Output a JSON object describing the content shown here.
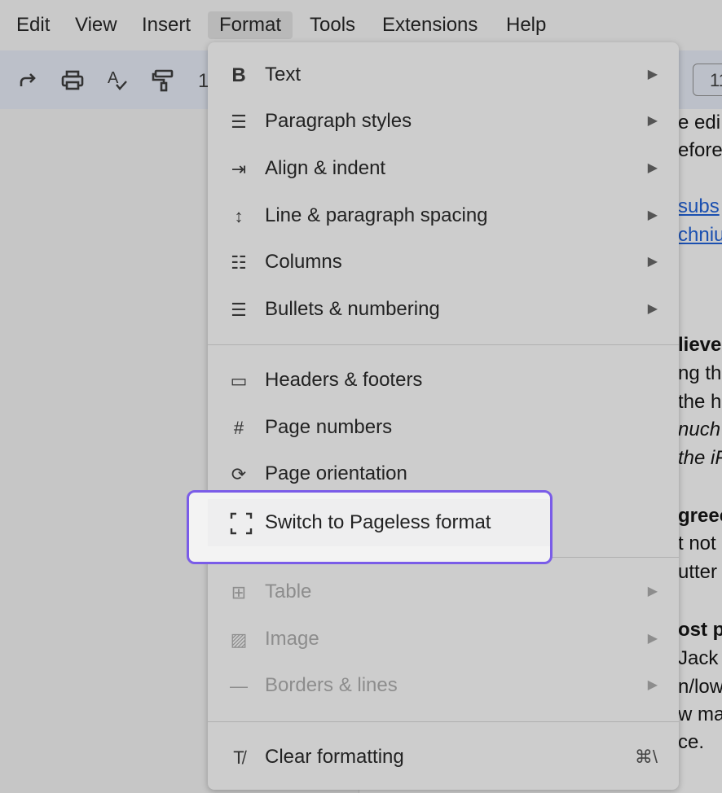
{
  "menubar": {
    "items": [
      "Edit",
      "View",
      "Insert",
      "Format",
      "Tools",
      "Extensions",
      "Help"
    ],
    "active": "Format"
  },
  "toolbar": {
    "icons": [
      "redo-icon",
      "print-icon",
      "spellcheck-icon",
      "paint-format-icon"
    ],
    "zoom_partial": "1",
    "font_size_partial": "11"
  },
  "document": {
    "lines": [
      {
        "t": "e edi",
        "s": ""
      },
      {
        "t": "efore",
        "s": ""
      },
      {
        "t": "subs",
        "s": "a"
      },
      {
        "t": "chniu",
        "s": "a"
      },
      {
        "t": "lieve",
        "s": "b"
      },
      {
        "t": "ng th",
        "s": ""
      },
      {
        "t": "the h",
        "s": ""
      },
      {
        "t": "nuch",
        "s": "i"
      },
      {
        "t": "the iF",
        "s": "i"
      },
      {
        "t": "greec",
        "s": "b"
      },
      {
        "t": "t not",
        "s": ""
      },
      {
        "t": "utter",
        "s": ""
      },
      {
        "t": "ost p",
        "s": "b"
      },
      {
        "t": "Jack",
        "s": ""
      },
      {
        "t": "n/low",
        "s": ""
      },
      {
        "t": "w ma",
        "s": ""
      },
      {
        "t": "ce.",
        "s": ""
      }
    ]
  },
  "format_menu": {
    "groups": [
      [
        {
          "label": "Text",
          "icon": "bold-icon",
          "submenu": true
        },
        {
          "label": "Paragraph styles",
          "icon": "paragraph-styles-icon",
          "submenu": true
        },
        {
          "label": "Align & indent",
          "icon": "indent-icon",
          "submenu": true
        },
        {
          "label": "Line & paragraph spacing",
          "icon": "line-spacing-icon",
          "submenu": true
        },
        {
          "label": "Columns",
          "icon": "columns-icon",
          "submenu": true
        },
        {
          "label": "Bullets & numbering",
          "icon": "bulleted-list-icon",
          "submenu": true
        }
      ],
      [
        {
          "label": "Headers & footers",
          "icon": "header-footer-icon"
        },
        {
          "label": "Page numbers",
          "icon": "hash-icon"
        },
        {
          "label": "Page orientation",
          "icon": "page-orientation-icon"
        },
        {
          "label": "Switch to Pageless format",
          "icon": "pageless-icon",
          "highlighted": true
        }
      ],
      [
        {
          "label": "Table",
          "icon": "table-icon",
          "submenu": true,
          "disabled": true
        },
        {
          "label": "Image",
          "icon": "image-icon",
          "submenu": true,
          "disabled": true
        },
        {
          "label": "Borders & lines",
          "icon": "border-line-icon",
          "submenu": true,
          "disabled": true
        }
      ],
      [
        {
          "label": "Clear formatting",
          "icon": "clear-formatting-icon",
          "shortcut": "⌘\\"
        }
      ]
    ]
  },
  "colors": {
    "highlight_border": "#7a5ce8",
    "link": "#1a4fb0"
  }
}
